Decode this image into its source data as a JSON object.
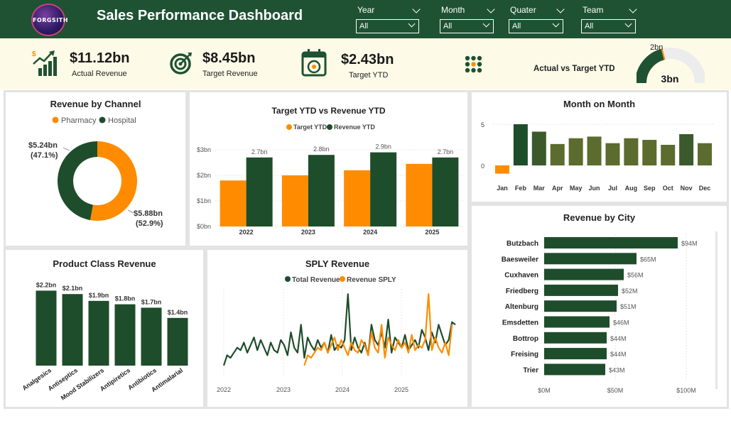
{
  "header": {
    "title": "Sales Performance Dashboard",
    "logo_text": "FORGSITH",
    "filters": [
      {
        "label": "Year",
        "value": "All"
      },
      {
        "label": "Month",
        "value": "All"
      },
      {
        "label": "Quater",
        "value": "All"
      },
      {
        "label": "Team",
        "value": "All"
      }
    ]
  },
  "kpis": {
    "actual_revenue": {
      "value": "$11.12bn",
      "label": "Actual Revenue"
    },
    "target_revenue": {
      "value": "$8.45bn",
      "label": "Target Revenue"
    },
    "target_ytd": {
      "value": "$2.43bn",
      "label": "Target YTD"
    },
    "gauge": {
      "label": "Actual vs Target YTD",
      "top_label": "2bn",
      "center_label": "3bn",
      "fill_fraction": 0.42
    }
  },
  "colors": {
    "green": "#1e4d2b",
    "orange": "#ff8c00",
    "olive": "#5c6b2e",
    "header": "#1e5233"
  },
  "chart_data": [
    {
      "id": "revenue_by_channel",
      "type": "pie",
      "title": "Revenue by Channel",
      "legend": [
        "Pharmacy",
        "Hospital"
      ],
      "slices": [
        {
          "name": "Pharmacy",
          "value": 5.88,
          "label": "$5.88bn",
          "pct": "(52.9%)",
          "color": "#ff8c00"
        },
        {
          "name": "Hospital",
          "value": 5.24,
          "label": "$5.24bn",
          "pct": "(47.1%)",
          "color": "#1e4d2b"
        }
      ]
    },
    {
      "id": "target_vs_revenue_ytd",
      "type": "bar",
      "title": "Target YTD vs Revenue YTD",
      "categories": [
        "2022",
        "2023",
        "2024",
        "2025"
      ],
      "series": [
        {
          "name": "Target YTD",
          "values": [
            1.8,
            2.0,
            2.2,
            2.45
          ],
          "color": "#ff8c00"
        },
        {
          "name": "Revenue YTD",
          "values": [
            2.7,
            2.8,
            2.9,
            2.7
          ],
          "color": "#1e4d2b"
        }
      ],
      "data_labels": [
        "2.7bn",
        "2.8bn",
        "2.9bn",
        "2.7bn"
      ],
      "yticks": [
        "$0bn",
        "$1bn",
        "$2bn",
        "$3bn"
      ],
      "ylim": [
        0,
        3
      ]
    },
    {
      "id": "month_on_month",
      "type": "bar",
      "title": "Month on Month",
      "categories": [
        "Jan",
        "Feb",
        "Mar",
        "Apr",
        "May",
        "Jun",
        "Jul",
        "Aug",
        "Sep",
        "Oct",
        "Nov",
        "Dec"
      ],
      "values": [
        -1.0,
        5.0,
        4.1,
        2.6,
        3.3,
        3.5,
        2.7,
        3.3,
        3.1,
        2.5,
        3.8,
        2.7
      ],
      "yticks": [
        "0",
        "5"
      ],
      "ylim": [
        -1.3,
        5.2
      ]
    },
    {
      "id": "revenue_by_city",
      "type": "bar",
      "title": "Revenue by City",
      "categories": [
        "Butzbach",
        "Baesweiler",
        "Cuxhaven",
        "Friedberg",
        "Altenburg",
        "Emsdetten",
        "Bottrop",
        "Freising",
        "Trier"
      ],
      "values": [
        94,
        65,
        56,
        52,
        51,
        46,
        44,
        44,
        43
      ],
      "data_labels": [
        "$94M",
        "$65M",
        "$56M",
        "$52M",
        "$51M",
        "$46M",
        "$44M",
        "$44M",
        "$43M"
      ],
      "xticks": [
        "$0M",
        "$50M",
        "$100M"
      ],
      "xlim": [
        0,
        100
      ]
    },
    {
      "id": "product_class_revenue",
      "type": "bar",
      "title": "Product Class Revenue",
      "categories": [
        "Analgesics",
        "Antiseptics",
        "Mood Stabilizers",
        "Antipiretics",
        "Antibiotics",
        "Antimalarial"
      ],
      "values": [
        2.2,
        2.1,
        1.9,
        1.8,
        1.7,
        1.4
      ],
      "data_labels": [
        "$2.2bn",
        "$2.1bn",
        "$1.9bn",
        "$1.8bn",
        "$1.7bn",
        "$1.4bn"
      ]
    },
    {
      "id": "sply_revenue",
      "type": "line",
      "title": "SPLY Revenue",
      "xticks": [
        "2022",
        "2023",
        "2024",
        "2025"
      ],
      "series": [
        {
          "name": "Total Revenue",
          "color": "#1e4d2b",
          "values": [
            2,
            6,
            5,
            7,
            9,
            8,
            11,
            7,
            10,
            13,
            8,
            12,
            9,
            6,
            11,
            8,
            7,
            12,
            10,
            6,
            15,
            9,
            7,
            18,
            5,
            13,
            10,
            8,
            12,
            9,
            11,
            7,
            14,
            8,
            10,
            9,
            12,
            30,
            8,
            13,
            9,
            7,
            11,
            6,
            18,
            12,
            10,
            15,
            9,
            20,
            7,
            13,
            11,
            9,
            14,
            8,
            10,
            12,
            9,
            16,
            13,
            8,
            15,
            11,
            18,
            14,
            10,
            12,
            19,
            18
          ]
        },
        {
          "name": "Revenue SPLY",
          "color": "#ff8c00",
          "start": 24,
          "values": [
            2,
            6,
            5,
            7,
            9,
            8,
            11,
            7,
            10,
            13,
            8,
            12,
            9,
            6,
            11,
            8,
            7,
            12,
            10,
            6,
            15,
            9,
            7,
            18,
            5,
            13,
            10,
            8,
            12,
            9,
            11,
            7,
            14,
            8,
            10,
            9,
            12,
            30,
            8,
            13,
            9,
            7,
            11,
            6,
            18
          ]
        }
      ]
    }
  ]
}
